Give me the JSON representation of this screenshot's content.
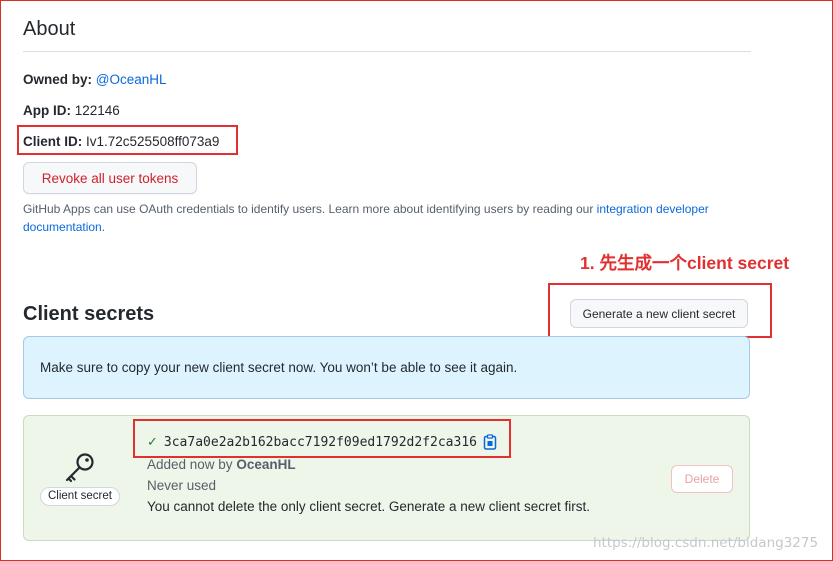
{
  "about": {
    "title": "About",
    "owned_by_label": "Owned by:",
    "owned_by_value": "@OceanHL",
    "app_id_label": "App ID:",
    "app_id_value": "122146",
    "client_id_label": "Client ID:",
    "client_id_value": "Iv1.72c525508ff073a9",
    "revoke_button": "Revoke all user tokens",
    "oauth_note_text": "GitHub Apps can use OAuth credentials to identify users. Learn more about identifying users by reading our ",
    "oauth_note_link": "integration developer documentation",
    "oauth_note_end": "."
  },
  "annotation": {
    "step_text": "1. 先生成一个client secret",
    "color": "#e0302f"
  },
  "client_secrets": {
    "title": "Client secrets",
    "generate_button": "Generate a new client secret",
    "flash_message": "Make sure to copy your new client secret now. You won’t be able to see it again.",
    "secret": {
      "icon": "key-icon",
      "label": "Client secret",
      "value": "3ca7a0e2a2b162bacc7192f09ed1792d2f2ca316",
      "added_prefix": "Added now by ",
      "added_by": "OceanHL",
      "usage": "Never used",
      "warning": "You cannot delete the only client secret. Generate a new client secret first.",
      "delete_button": "Delete"
    }
  },
  "watermark": "https://blog.csdn.net/bidang3275",
  "colors": {
    "link": "#0969da",
    "danger": "#cf222e",
    "flash_bg": "#ddf4ff",
    "card_bg": "#eef6ea",
    "success": "#1a7f37"
  }
}
